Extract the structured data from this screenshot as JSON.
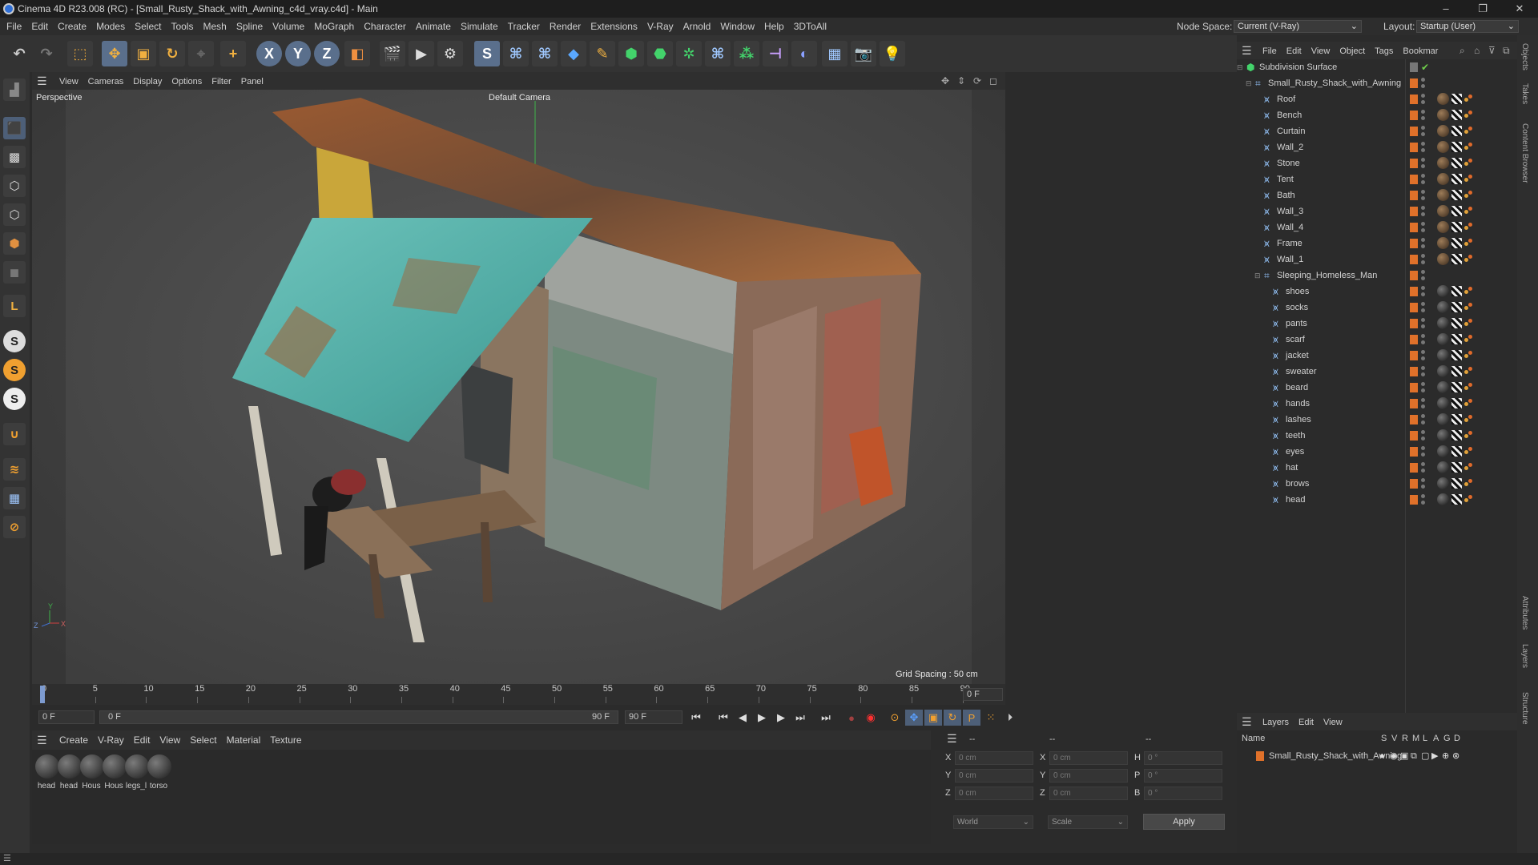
{
  "window": {
    "title": "Cinema 4D R23.008 (RC) - [Small_Rusty_Shack_with_Awning_c4d_vray.c4d] - Main",
    "min": "–",
    "max": "❐",
    "close": "✕"
  },
  "menubar": {
    "items": [
      "File",
      "Edit",
      "Create",
      "Modes",
      "Select",
      "Tools",
      "Mesh",
      "Spline",
      "Volume",
      "MoGraph",
      "Character",
      "Animate",
      "Simulate",
      "Tracker",
      "Render",
      "Extensions",
      "V-Ray",
      "Arnold",
      "Window",
      "Help",
      "3DToAll"
    ],
    "node_space_label": "Node Space:",
    "node_space_value": "Current (V-Ray)",
    "layout_label": "Layout:",
    "layout_value": "Startup (User)"
  },
  "toolbar": {
    "axis_x": "X",
    "axis_y": "Y",
    "axis_z": "Z"
  },
  "viewport": {
    "menu": [
      "View",
      "Cameras",
      "Display",
      "Options",
      "Filter",
      "Panel"
    ],
    "label": "Perspective",
    "camera": "Default Camera",
    "grid_spacing": "Grid Spacing : 50 cm",
    "axis_y": "Y",
    "axis_z": "Z",
    "axis_x": "X"
  },
  "timeline": {
    "ticks": [
      "0",
      "5",
      "10",
      "15",
      "20",
      "25",
      "30",
      "35",
      "40",
      "45",
      "50",
      "55",
      "60",
      "65",
      "70",
      "75",
      "80",
      "85",
      "90"
    ],
    "current_frame_right": "0 F"
  },
  "transport": {
    "start_field": "0 F",
    "range_start": "0 F",
    "range_end": "90 F",
    "end_field": "90 F"
  },
  "material_manager": {
    "menu": [
      "Create",
      "V-Ray",
      "Edit",
      "View",
      "Select",
      "Material",
      "Texture"
    ],
    "materials": [
      "head",
      "head",
      "Hous",
      "Hous",
      "legs_l",
      "torso"
    ]
  },
  "coordinates": {
    "header": [
      "--",
      "--",
      "--"
    ],
    "rows": [
      {
        "axis1": "X",
        "v1": "0 cm",
        "axis2": "X",
        "v2": "0 cm",
        "axis3": "H",
        "v3": "0 °"
      },
      {
        "axis1": "Y",
        "v1": "0 cm",
        "axis2": "Y",
        "v2": "0 cm",
        "axis3": "P",
        "v3": "0 °"
      },
      {
        "axis1": "Z",
        "v1": "0 cm",
        "axis2": "Z",
        "v2": "0 cm",
        "axis3": "B",
        "v3": "0 °"
      }
    ],
    "mode": "World",
    "scale": "Scale",
    "apply": "Apply"
  },
  "object_manager": {
    "menu": [
      "File",
      "Edit",
      "View",
      "Object",
      "Tags",
      "Bookmar"
    ],
    "objects": [
      {
        "name": "Subdivision Surface",
        "level": 0
      },
      {
        "name": "Small_Rusty_Shack_with_Awning",
        "level": 1
      },
      {
        "name": "Roof",
        "level": 2
      },
      {
        "name": "Bench",
        "level": 2
      },
      {
        "name": "Curtain",
        "level": 2
      },
      {
        "name": "Wall_2",
        "level": 2
      },
      {
        "name": "Stone",
        "level": 2
      },
      {
        "name": "Tent",
        "level": 2
      },
      {
        "name": "Bath",
        "level": 2
      },
      {
        "name": "Wall_3",
        "level": 2
      },
      {
        "name": "Wall_4",
        "level": 2
      },
      {
        "name": "Frame",
        "level": 2
      },
      {
        "name": "Wall_1",
        "level": 2
      },
      {
        "name": "Sleeping_Homeless_Man",
        "level": 2
      },
      {
        "name": "shoes",
        "level": 3
      },
      {
        "name": "socks",
        "level": 3
      },
      {
        "name": "pants",
        "level": 3
      },
      {
        "name": "scarf",
        "level": 3
      },
      {
        "name": "jacket",
        "level": 3
      },
      {
        "name": "sweater",
        "level": 3
      },
      {
        "name": "beard",
        "level": 3
      },
      {
        "name": "hands",
        "level": 3
      },
      {
        "name": "lashes",
        "level": 3
      },
      {
        "name": "teeth",
        "level": 3
      },
      {
        "name": "eyes",
        "level": 3
      },
      {
        "name": "hat",
        "level": 3
      },
      {
        "name": "brows",
        "level": 3
      },
      {
        "name": "head",
        "level": 3
      }
    ]
  },
  "layer_manager": {
    "menu": [
      "Layers",
      "Edit",
      "View"
    ],
    "columns": [
      "Name",
      "S",
      "V",
      "R",
      "M",
      "L",
      "A",
      "G",
      "D"
    ],
    "layers": [
      {
        "name": "Small_Rusty_Shack_with_Awning",
        "color": "#e0712a"
      }
    ]
  },
  "right_tabs": [
    "Objects",
    "Takes",
    "Content Browser",
    "Attributes",
    "Layers",
    "Structure"
  ],
  "colors": {
    "accent": "#e0712a",
    "selection": "#5a6f8c",
    "green_check": "#6fcf4b"
  }
}
